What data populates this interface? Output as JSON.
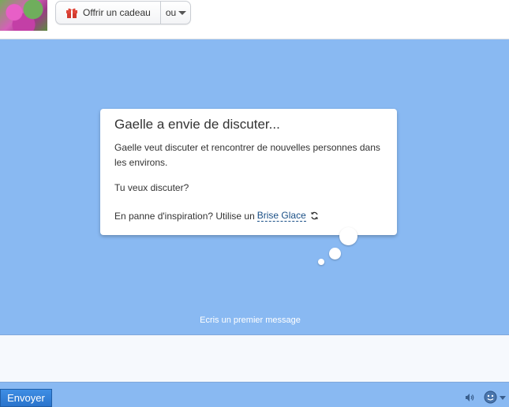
{
  "header": {
    "gift_label": "Offrir un cadeau",
    "or_label": "ou"
  },
  "bubble": {
    "title": "Gaelle a envie de discuter...",
    "paragraph1": "Gaelle veut discuter et rencontrer de nouvelles personnes dans les environs.",
    "paragraph2": "Tu veux discuter?",
    "inspiration_prefix": "En panne d'inspiration? Utilise un",
    "icebreaker_link": "Brise Glace"
  },
  "chat": {
    "hint": "Ecris un premier message"
  },
  "composer": {
    "message_value": "",
    "send_label": "Envoyer"
  },
  "colors": {
    "chat_background": "#89b9f2",
    "send_button": "#2f7fd8",
    "link": "#1a4f86"
  },
  "icons": [
    "gift-icon",
    "chevron-down-icon",
    "refresh-icon",
    "speaker-icon",
    "smiley-icon"
  ]
}
